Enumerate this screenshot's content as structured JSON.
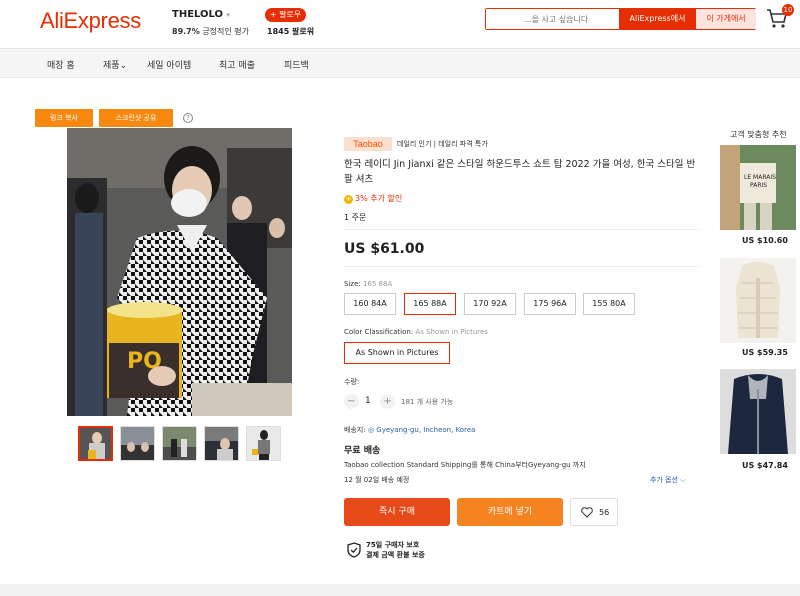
{
  "header": {
    "logo": "AliExpress",
    "store_name": "THELOLO",
    "store_caret": "▾",
    "store_rating_value": "89.7%",
    "store_rating_text": "긍정적인 평가",
    "follow_label": "+ 팔로우",
    "followers": "1845 팔로워",
    "search_placeholder": "...을 사고 싶습니다",
    "search_aliexpress": "AliExpress에서",
    "search_store": "이 가게에서",
    "cart_count": "10"
  },
  "nav": [
    "매장 홈",
    "제품",
    "세일 아이템",
    "최고 매출",
    "피드백"
  ],
  "nav_caret": "⌄",
  "share": {
    "copy_link": "링크 복사",
    "screenshot_share": "스크린샷 공유",
    "help": "?"
  },
  "product": {
    "taobao_badge": "Taobao",
    "taobao_tagline": "데일리 인기 | 데일리 파격 특가",
    "title": "한국 레이디 Jin Jianxi 같은 스타일 하운드투스 쇼트 탑 2022 가을 여성, 한국 스타일 반팔 셔츠",
    "discount": "3% 추가 할인",
    "discount_icon": "+",
    "orders": "1 주문",
    "price": "US $61.00",
    "size_label": "Size:",
    "size_selected": "165 88A",
    "sizes": [
      "160 84A",
      "165 88A",
      "170 92A",
      "175 96A",
      "155 80A"
    ],
    "color_label": "Color Classification:",
    "color_selected": "As Shown in Pictures",
    "color_option": "As Shown in Pictures",
    "qty_label": "수량:",
    "qty_value": "1",
    "qty_minus": "−",
    "qty_plus": "+",
    "qty_available": "181 개 사용 가능",
    "ship_label": "배송지:",
    "ship_location": "Gyeyang-gu, Incheon, Korea",
    "ship_title": "무료 배송",
    "ship_desc": "Taobao collection Standard Shipping를 통해 China부터Gyeyang-gu 까지",
    "ship_date": "12 월 02일 배송 예정",
    "more_options": "추가 옵션 ⌵",
    "buy_now": "즉시 구매",
    "add_cart": "카트에 넣기",
    "wishlist_count": "56",
    "protect_title": "75일 구매자 보호",
    "protect_desc": "결제 금액 환불 보증"
  },
  "recommend": {
    "title": "고객 맞춤형 추천",
    "items": [
      {
        "price": "US $10.60"
      },
      {
        "price": "US $59.35"
      },
      {
        "price": "US $47.84"
      }
    ]
  },
  "colors": {
    "brand": "#e62e04",
    "orange": "#f7890f",
    "buy": "#e64a19",
    "cart": "#f5831f"
  }
}
